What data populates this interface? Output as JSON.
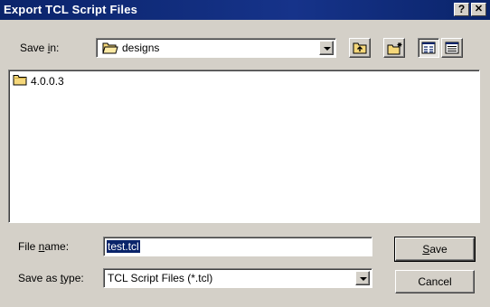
{
  "window": {
    "title": "Export TCL Script Files",
    "help_label": "?",
    "close_label": "✕"
  },
  "save_in": {
    "label_before": "Save ",
    "label_key": "i",
    "label_after": "n:",
    "value": "designs",
    "icon": "folder-open-icon"
  },
  "toolbar": {
    "up_icon": "up-one-level-icon",
    "new_folder_icon": "new-folder-icon",
    "list_view_icon": "list-view-icon",
    "details_view_icon": "details-view-icon"
  },
  "files": [
    {
      "name": "4.0.0.3",
      "icon": "folder-icon"
    }
  ],
  "file_name": {
    "label_before": "File ",
    "label_key": "n",
    "label_after": "ame:",
    "value": "test.tcl"
  },
  "save_as_type": {
    "label_before": "Save as ",
    "label_key": "t",
    "label_after": "ype:",
    "value": "TCL Script Files (*.tcl)"
  },
  "buttons": {
    "save_key": "S",
    "save_rest": "ave",
    "cancel": "Cancel"
  },
  "colors": {
    "titlebar": "#0a246a",
    "face": "#d4d0c8",
    "selection": "#0a246a",
    "folder": "#f5d77a"
  }
}
